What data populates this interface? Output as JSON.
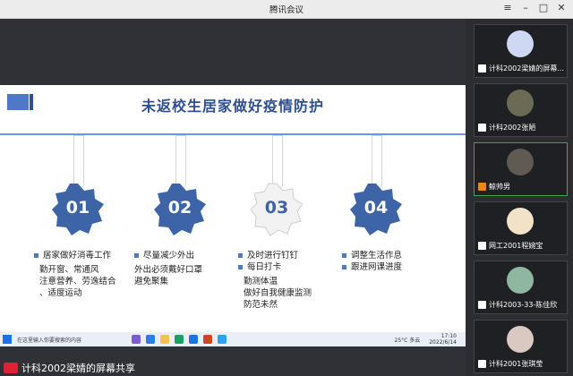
{
  "window": {
    "title": "腾讯会议",
    "buttons": [
      "≡",
      "–",
      "□",
      "✕"
    ]
  },
  "slide": {
    "title": "未返校生居家做好疫情防护",
    "badges": [
      "01",
      "02",
      "03",
      "04"
    ],
    "columns": [
      {
        "head": "居家做好消毒工作",
        "lines": [
          "勤开窗、常通风",
          "注意营养、劳逸结合",
          "、适度运动"
        ]
      },
      {
        "head": "尽量减少外出",
        "lines": [
          "外出必须戴好口罩",
          "避免聚集"
        ]
      },
      {
        "head": "及时进行钉钉",
        "head2": "每日打卡",
        "lines": [
          "勤测体温",
          "做好自我健康监测",
          "防范未然"
        ]
      },
      {
        "head": "调整生活作息",
        "head2": "跟进网课进度",
        "lines": []
      }
    ]
  },
  "taskbar": {
    "search_placeholder": "在这里输入你要搜索的内容",
    "weather": "25°C 多云",
    "time": "17:10",
    "date": "2022/6/14"
  },
  "share": {
    "label": "计科2002梁婧的屏幕共享"
  },
  "participants": [
    {
      "name": "计科2002梁婧的屏幕...",
      "icon": "screen-share-icon"
    },
    {
      "name": "计科2002张陋",
      "icon": "mic-icon"
    },
    {
      "name": "鲸帅男",
      "icon": "mic-icon"
    },
    {
      "name": "网工2001程婉宝",
      "icon": "mic-icon"
    },
    {
      "name": "计科2003-33-陈佳欣",
      "icon": "mic-icon"
    },
    {
      "name": "计科2001张琪莹",
      "icon": "mic-icon"
    }
  ],
  "colors": {
    "accent": "#4f78c7",
    "title": "#2f4f91",
    "background": "#2b2d31"
  }
}
